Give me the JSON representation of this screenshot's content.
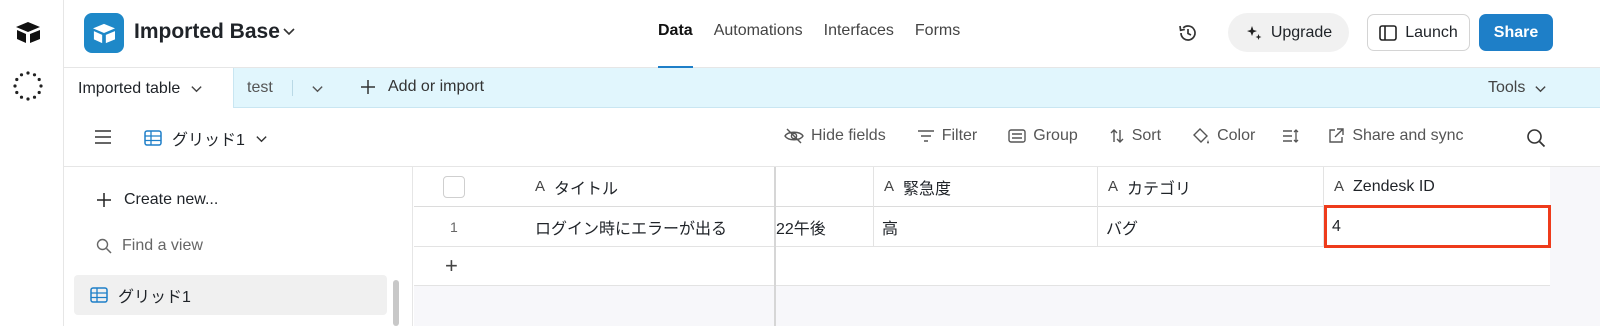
{
  "header": {
    "base_title": "Imported Base",
    "nav": {
      "data": "Data",
      "automations": "Automations",
      "interfaces": "Interfaces",
      "forms": "Forms"
    },
    "upgrade_label": "Upgrade",
    "launch_label": "Launch",
    "share_label": "Share"
  },
  "tabs": {
    "active_label": "Imported table",
    "other_label": "test",
    "add_import_label": "Add or import",
    "tools_label": "Tools"
  },
  "toolbar": {
    "view_name": "グリッド1",
    "hide_fields": "Hide fields",
    "filter": "Filter",
    "group": "Group",
    "sort": "Sort",
    "color": "Color",
    "share_sync": "Share and sync"
  },
  "sidebar": {
    "create_new": "Create new...",
    "find_view_placeholder": "Find a view",
    "views": [
      {
        "label": "グリッド1"
      }
    ]
  },
  "grid": {
    "columns": {
      "title": "タイトル",
      "urgency": "緊急度",
      "category": "カテゴリ",
      "zendesk_id": "Zendesk ID"
    },
    "rows": [
      {
        "number": "1",
        "title": "ログイン時にエラーが出る",
        "date_partial": "22午後",
        "urgency": "高",
        "category": "バグ",
        "zendesk_id": "4"
      }
    ],
    "add_row": "+"
  },
  "colors": {
    "accent": "#1e7fc8",
    "tabs_bg": "#e1f6fd",
    "highlight": "#ee3b1b"
  }
}
